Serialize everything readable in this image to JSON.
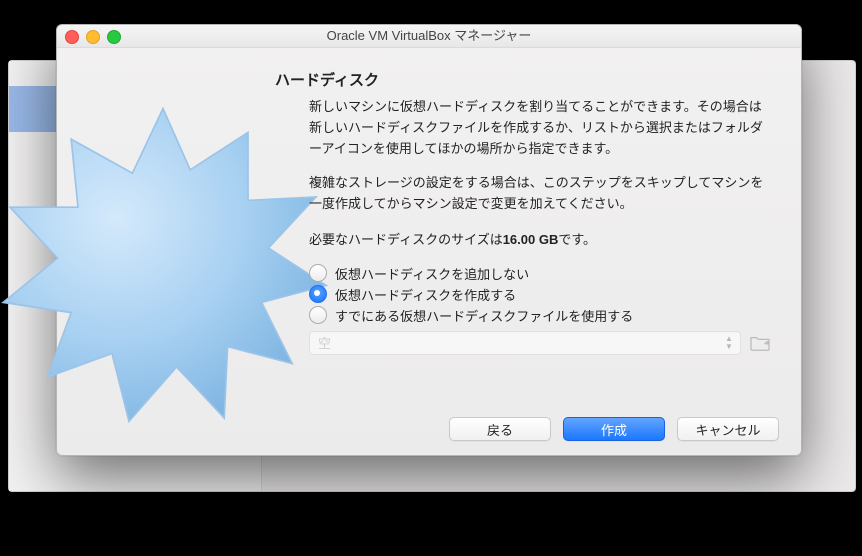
{
  "window": {
    "title": "Oracle VM VirtualBox マネージャー"
  },
  "wizard": {
    "heading": "ハードディスク",
    "paragraphs": [
      "新しいマシンに仮想ハードディスクを割り当てることができます。その場合は新しいハードディスクファイルを作成するか、リストから選択またはフォルダーアイコンを使用してほかの場所から指定できます。",
      "複雑なストレージの設定をする場合は、このステップをスキップしてマシンを一度作成してからマシン設定で変更を加えてください。"
    ],
    "size_prefix": "必要なハードディスクのサイズは",
    "size_value": "16.00 GB",
    "size_suffix": "です。",
    "options": {
      "none": "仮想ハードディスクを追加しない",
      "create": "仮想ハードディスクを作成する",
      "use": "すでにある仮想ハードディスクファイルを使用する"
    },
    "combo_placeholder": "空"
  },
  "buttons": {
    "back": "戻る",
    "create": "作成",
    "cancel": "キャンセル"
  }
}
